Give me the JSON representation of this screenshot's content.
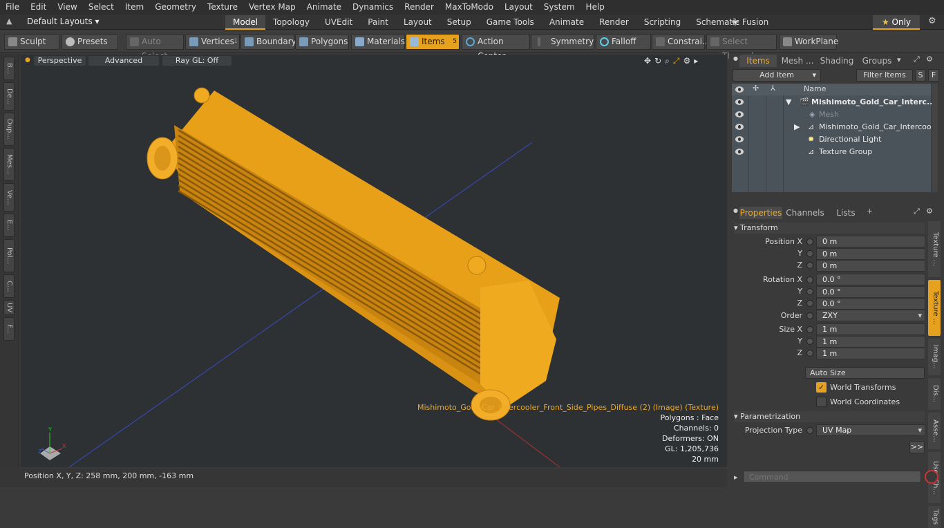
{
  "menu": [
    "File",
    "Edit",
    "View",
    "Select",
    "Item",
    "Geometry",
    "Texture",
    "Vertex Map",
    "Animate",
    "Dynamics",
    "Render",
    "MaxToModo",
    "Layout",
    "System",
    "Help"
  ],
  "layouts": {
    "label": "Default Layouts ▾"
  },
  "mode_tabs": [
    "Model",
    "Topology",
    "UVEdit",
    "Paint",
    "Layout",
    "Setup",
    "Game Tools",
    "Animate",
    "Render",
    "Scripting",
    "Schematic Fusion"
  ],
  "only_label": "Only",
  "toolbar": {
    "sculpt": "Sculpt",
    "presets": "Presets",
    "auto_select": "Auto Select",
    "vertices": "Vertices",
    "vertices_count": "1",
    "boundary": "Boundary",
    "polygons": "Polygons",
    "materials": "Materials",
    "items": "Items",
    "items_count": "5",
    "action_center": "Action Center",
    "symmetry": "Symmetry",
    "falloff": "Falloff",
    "constraints": "Constrai...",
    "select_through": "Select Through",
    "workplane": "WorkPlane"
  },
  "left_tabs": [
    "B...",
    "De...",
    "Dup...",
    "Mes...",
    "Ve...",
    "E...",
    "Pol...",
    "C...",
    "UV",
    "F..."
  ],
  "viewport": {
    "perspective": "Perspective",
    "advanced": "Advanced",
    "raygl": "Ray GL: Off",
    "info": {
      "title": "Mishimoto_Gold_Car_Intercooler_Front_Side_Pipes_Diffuse (2) (Image) (Texture)",
      "polygons": "Polygons : Face",
      "channels": "Channels: 0",
      "deformers": "Deformers: ON",
      "gl": "GL: 1,205,736",
      "scale": "20 mm"
    },
    "axis_x": "X",
    "axis_y": "Y",
    "axis_z": "Z"
  },
  "status": {
    "position": "Position X, Y, Z:  258 mm, 200 mm, -163 mm"
  },
  "items_panel": {
    "tabs": [
      "Items",
      "Mesh ...",
      "Shading",
      "Groups"
    ],
    "add_item": "Add Item",
    "filter": "Filter Items",
    "s": "S",
    "f": "F",
    "name_header": "Name",
    "rows": [
      "Mishimoto_Gold_Car_Interc...",
      "Mesh",
      "Mishimoto_Gold_Car_Intercool ...",
      "Directional Light",
      "Texture Group"
    ]
  },
  "props_panel": {
    "tabs": [
      "Properties",
      "Channels",
      "Lists"
    ],
    "transform": "Transform",
    "pos_x": "Position X",
    "y": "Y",
    "z": "Z",
    "rot_x": "Rotation X",
    "order": "Order",
    "size_x": "Size X",
    "pos_vals": [
      "0 m",
      "0 m",
      "0 m"
    ],
    "rot_vals": [
      "0.0 °",
      "0.0 °",
      "0.0 °"
    ],
    "order_val": "ZXY",
    "size_vals": [
      "1 m",
      "1 m",
      "1 m"
    ],
    "auto_size": "Auto Size",
    "world_transforms": "World Transforms",
    "world_coords": "World Coordinates",
    "parametrization": "Parametrization",
    "projection_type": "Projection Type",
    "projection_val": "UV Map",
    "more": ">>"
  },
  "right_vtabs": [
    "Texture ...",
    "Texture ...",
    "Imag...",
    "Dis...",
    "Asse...",
    "User Ch...",
    "Tags"
  ],
  "command_placeholder": "Command",
  "colors": {
    "accent": "#e6a11e",
    "model": "#f2a81c"
  }
}
